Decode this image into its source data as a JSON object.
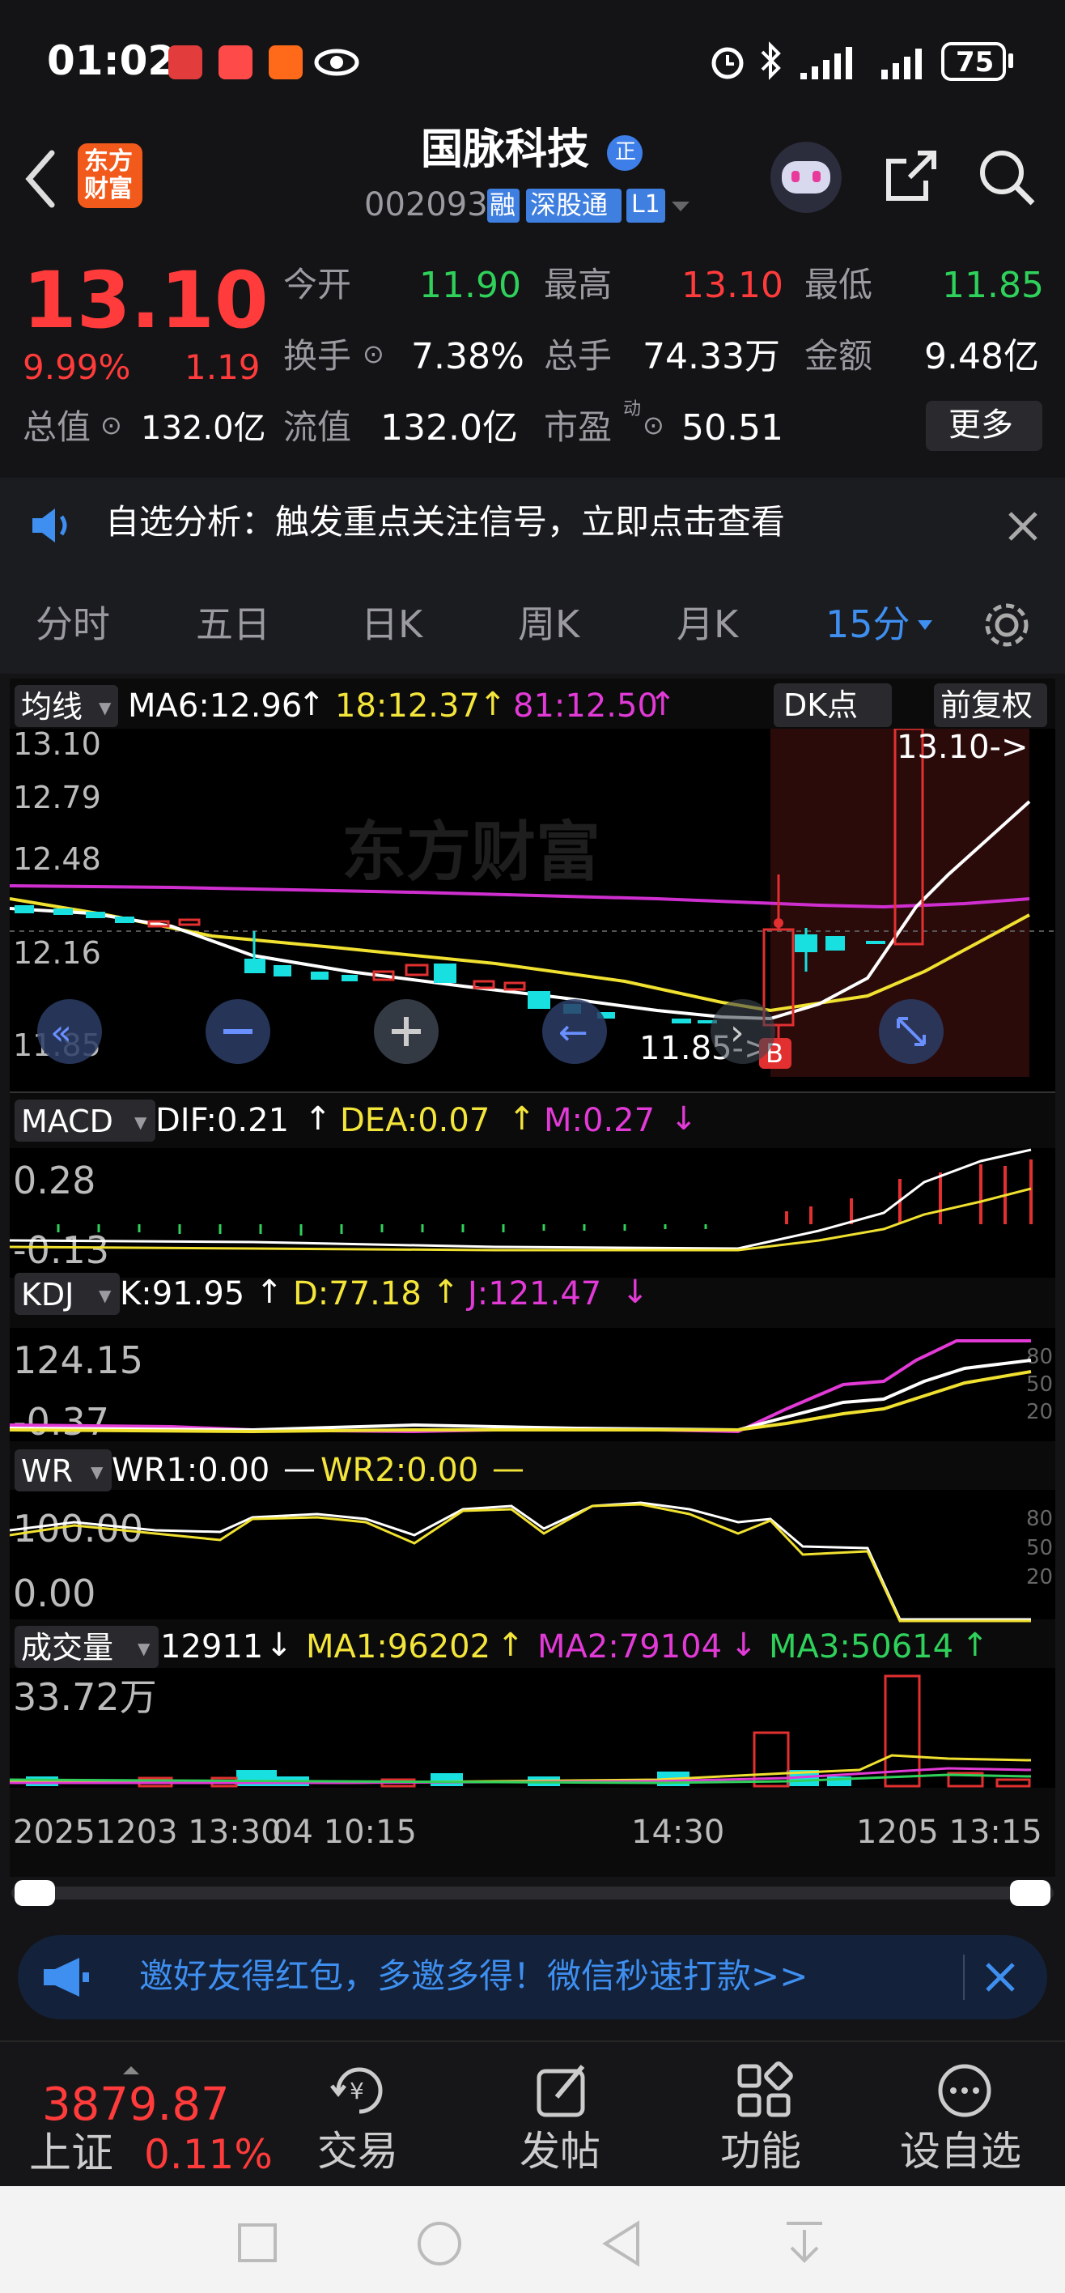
{
  "status_bar": {
    "time": "01:02",
    "battery": "75",
    "icons": [
      "huawei-app-icon",
      "red-app-icon",
      "orange-app-icon",
      "eye-icon",
      "alarm-icon",
      "bluetooth-icon",
      "signal-icon",
      "signal-icon",
      "battery-icon"
    ]
  },
  "header": {
    "logo_line1": "东方",
    "logo_line2": "财富",
    "title": "国脉科技",
    "title_badge": "正",
    "code": "002093",
    "tag_rong": "融",
    "tag_exchange": "深股通",
    "tag_level": "L1"
  },
  "quote": {
    "price": "13.10",
    "change_pct": "9.99%",
    "change": "1.19",
    "open_label": "今开",
    "open": "11.90",
    "high_label": "最高",
    "high": "13.10",
    "low_label": "最低",
    "low": "11.85",
    "turnover_label": "换手",
    "turnover": "7.38%",
    "volume_label": "总手",
    "volume": "74.33万",
    "amount_label": "金额",
    "amount": "9.48亿",
    "mktcap_label": "总值",
    "mktcap": "132.0亿",
    "float_label": "流值",
    "float": "132.0亿",
    "pe_label": "市盈",
    "pe_sup": "动",
    "pe": "50.51",
    "more_button": "更多"
  },
  "alert": {
    "text": "自选分析：触发重点关注信号，立即点击查看"
  },
  "tabs": [
    "分时",
    "五日",
    "日K",
    "周K",
    "月K",
    "15分"
  ],
  "chart": {
    "ma_selector": "均线",
    "ma6": "MA6:12.96",
    "ma6_arrow": "↑",
    "ma18": "18:12.37",
    "ma18_arrow": "↑",
    "ma81": "81:12.50",
    "ma81_arrow": "↑",
    "dk_button": "DK点",
    "fq_button": "前复权",
    "y_labels": [
      "13.10",
      "12.79",
      "12.48",
      "12.16",
      "11.85"
    ],
    "high_marker": "13.10->",
    "low_marker": "11.85->",
    "buy_marker": "B",
    "watermark": "东方财富",
    "macd_selector": "MACD",
    "dif": "DIF:0.21",
    "dif_arrow": "↑",
    "dea": "DEA:0.07",
    "dea_arrow": "↑",
    "m": "M:0.27",
    "m_arrow": "↓",
    "macd_y": [
      "0.28",
      "-0.13"
    ],
    "kdj_selector": "KDJ",
    "k": "K:91.95",
    "k_arrow": "↑",
    "d": "D:77.18",
    "d_arrow": "↑",
    "j": "J:121.47",
    "j_arrow": "↓",
    "kdj_y": [
      "124.15",
      "-0.37"
    ],
    "kdj_right": [
      "80",
      "50",
      "20"
    ],
    "wr_selector": "WR",
    "wr1": "WR1:0.00",
    "wr1_arrow": "—",
    "wr2": "WR2:0.00",
    "wr2_arrow": "—",
    "wr_y": [
      "100.00",
      "0.00"
    ],
    "wr_right": [
      "80",
      "50",
      "20"
    ],
    "vol_selector": "成交量",
    "vol": "12911",
    "vol_arrow": "↓",
    "vma1": "MA1:96202",
    "vma1_arrow": "↑",
    "vma2": "MA2:79104",
    "vma2_arrow": "↓",
    "vma3": "MA3:50614",
    "vma3_arrow": "↑",
    "vol_y": "33.72万",
    "x_labels": [
      "20251203 13:30",
      "04 10:15",
      "14:30",
      "1205 13:15"
    ]
  },
  "invite": {
    "text": "邀好友得红包，多邀多得！微信秒速打款>>"
  },
  "bottom_nav": {
    "index_value": "3879.87",
    "index_name": "上证",
    "index_pct": "0.11%",
    "items": [
      "交易",
      "发帖",
      "功能",
      "设自选"
    ]
  }
}
